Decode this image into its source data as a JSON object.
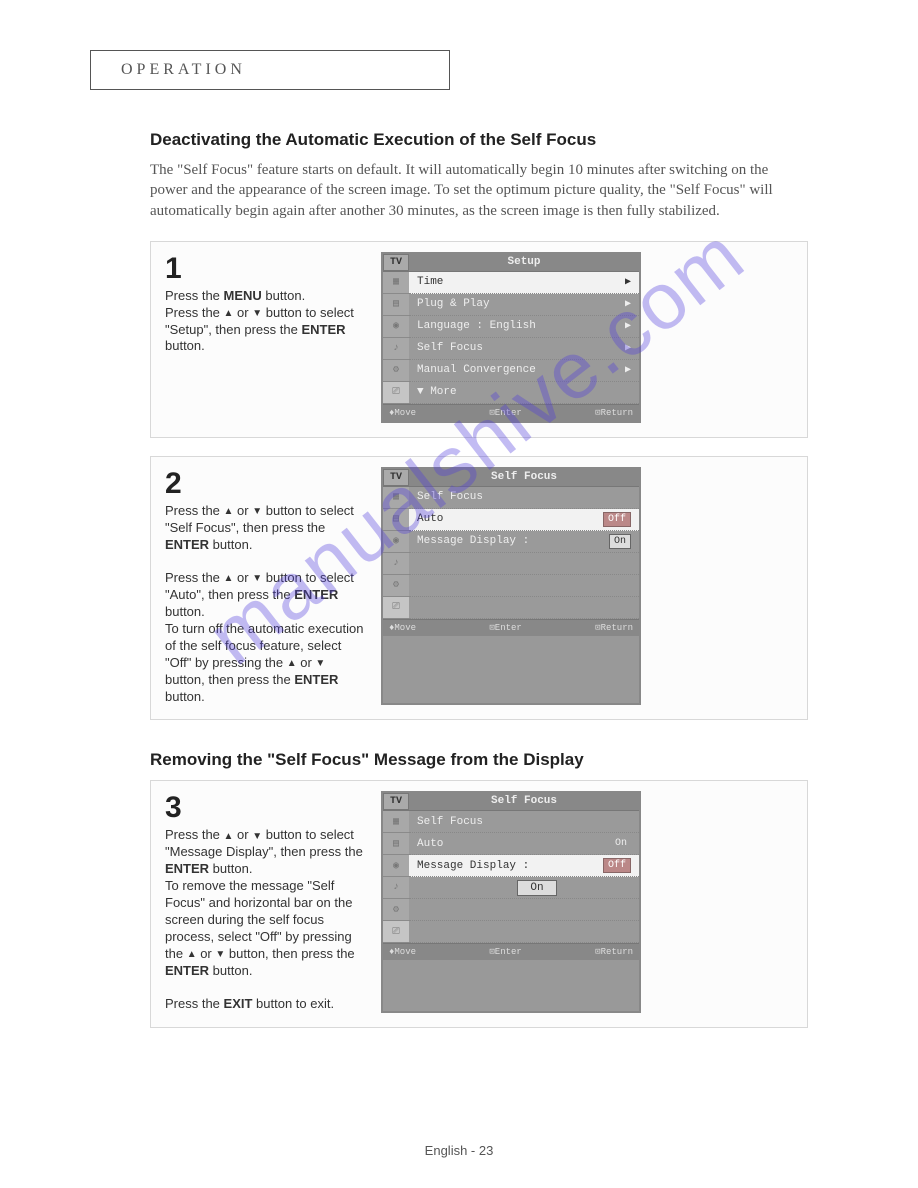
{
  "section_label": "OPERATION",
  "heading1": "Deactivating the Automatic Execution of the Self Focus",
  "intro1": "The \"Self Focus\" feature starts on default. It will automatically begin 10 minutes after switching on the power and the appearance of the screen image. To set the optimum picture quality, the \"Self Focus\" will automatically begin again after another 30 minutes, as the screen image is then fully stabilized.",
  "steps": [
    {
      "num": "1",
      "text_html": "Press the <b>MENU</b> button.<br>Press the <span class='tri'>▲</span> or <span class='tri'>▼</span> button to select \"Setup\", then press the <b>ENTER</b> button.",
      "menu": {
        "title": "Setup",
        "rows": [
          {
            "label": "Time",
            "arrow": "▶",
            "selected": true
          },
          {
            "label": "Plug & Play",
            "arrow": "▶"
          },
          {
            "label": "Language   :   English",
            "arrow": "▶"
          },
          {
            "label": "Self Focus",
            "arrow": "▶"
          },
          {
            "label": "Manual Convergence",
            "arrow": "▶"
          },
          {
            "label": "▼   More",
            "arrow": ""
          }
        ]
      }
    },
    {
      "num": "2",
      "text_html": "Press the <span class='tri'>▲</span> or <span class='tri'>▼</span> button to select \"Self Focus\", then press the <b>ENTER</b> button.<br><br>Press the <span class='tri'>▲</span> or <span class='tri'>▼</span> button to select \"Auto\", then press the <b>ENTER</b> button.<br>To turn off the automatic execution of the self focus feature, select \"Off\" by pressing the <span class='tri'>▲</span> or <span class='tri'>▼</span> button, then press the <b>ENTER</b> button.",
      "menu": {
        "title": "Self Focus",
        "rows": [
          {
            "label": "Self Focus",
            "arrow": ""
          },
          {
            "label": "Auto",
            "value": "Off",
            "valClass": "box-off",
            "selected": true
          },
          {
            "label": "Message Display  :",
            "value": "On",
            "valClass": "box-on"
          }
        ],
        "extra_rows": 3
      }
    }
  ],
  "heading2": "Removing the \"Self Focus\" Message from the Display",
  "step3": {
    "num": "3",
    "text_html": "Press the <span class='tri'>▲</span> or <span class='tri'>▼</span> button to select \"Message Display\", then press the <b>ENTER</b> button.<br>To remove the message \"Self Focus\" and horizontal bar on the screen during the self focus process, select \"Off\" by pressing the <span class='tri'>▲</span> or <span class='tri'>▼</span> button, then press the <b>ENTER</b> button.<br><br>Press the <b>EXIT</b> button to exit.",
    "menu": {
      "title": "Self Focus",
      "rows": [
        {
          "label": "Self Focus",
          "arrow": ""
        },
        {
          "label": "Auto",
          "value": "On",
          "labelDim": false
        },
        {
          "label": "Message Display  :",
          "value": "Off",
          "valClass": "box-off",
          "selected": true
        },
        {
          "label": "",
          "sub": "On"
        }
      ],
      "extra_rows": 2
    }
  },
  "tv_tab": "TV",
  "footer_items": {
    "move": "♦Move",
    "enter": "⊡Enter",
    "return": "⊡Return"
  },
  "page_footer": "English - 23",
  "watermark": "manualshive.com"
}
